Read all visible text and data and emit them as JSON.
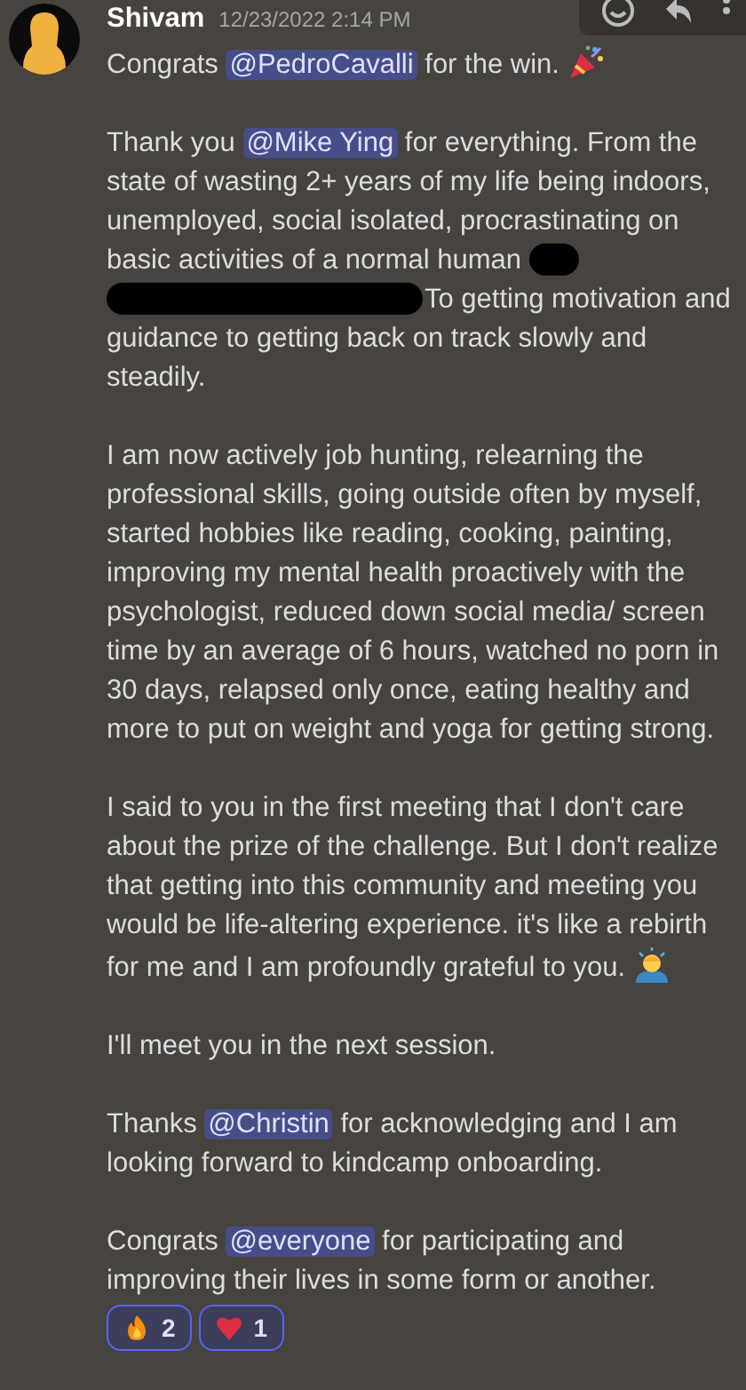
{
  "message": {
    "author": "Shivam",
    "timestamp": "12/23/2022 2:14 PM",
    "paragraphs": [
      {
        "parts": [
          {
            "kind": "text",
            "text": "Congrats "
          },
          {
            "kind": "mention",
            "text": "@PedroCavalli"
          },
          {
            "kind": "text",
            "text": " for the win. "
          },
          {
            "kind": "party"
          }
        ]
      },
      {
        "parts": [
          {
            "kind": "text",
            "text": "Thank you "
          },
          {
            "kind": "mention",
            "text": "@Mike Ying"
          },
          {
            "kind": "text",
            "text": " for everything. From the state of wasting 2+ years of my life being indoors, unemployed, social isolated, procrastinating on basic activities of a normal human "
          },
          {
            "kind": "redacted"
          },
          {
            "kind": "redacted-long"
          },
          {
            "kind": "text",
            "text": "To getting motivation and guidance to getting back on track slowly and steadily."
          }
        ]
      },
      {
        "parts": [
          {
            "kind": "text",
            "text": "I am now actively job hunting, relearning the professional skills, going outside often by myself, started hobbies like reading, cooking, painting, improving my mental health proactively with the psychologist, reduced down social media/ screen time by an average of 6 hours, watched no porn in 30 days, relapsed only once, eating healthy and more to put on weight and yoga for getting strong."
          }
        ]
      },
      {
        "parts": [
          {
            "kind": "text",
            "text": "I said to you in the first meeting that I don't care about the prize of the challenge. But I don't realize that getting into this community and meeting you would be life-altering experience. it's like a rebirth for me and I am profoundly grateful to you. "
          },
          {
            "kind": "bowing"
          }
        ]
      },
      {
        "parts": [
          {
            "kind": "text",
            "text": "I'll meet you in the next session."
          }
        ]
      },
      {
        "parts": [
          {
            "kind": "text",
            "text": "Thanks "
          },
          {
            "kind": "mention",
            "text": "@Christin"
          },
          {
            "kind": "text",
            "text": " for acknowledging and I am looking forward to kindcamp onboarding."
          }
        ]
      },
      {
        "parts": [
          {
            "kind": "text",
            "text": "Congrats "
          },
          {
            "kind": "mention",
            "text": "@everyone"
          },
          {
            "kind": "text",
            "text": " for participating and improving their lives in some form or another."
          }
        ]
      }
    ],
    "reactions": [
      {
        "kind": "fire",
        "count": "2",
        "selected": true
      },
      {
        "kind": "heart",
        "count": "1",
        "selected": true
      }
    ]
  }
}
